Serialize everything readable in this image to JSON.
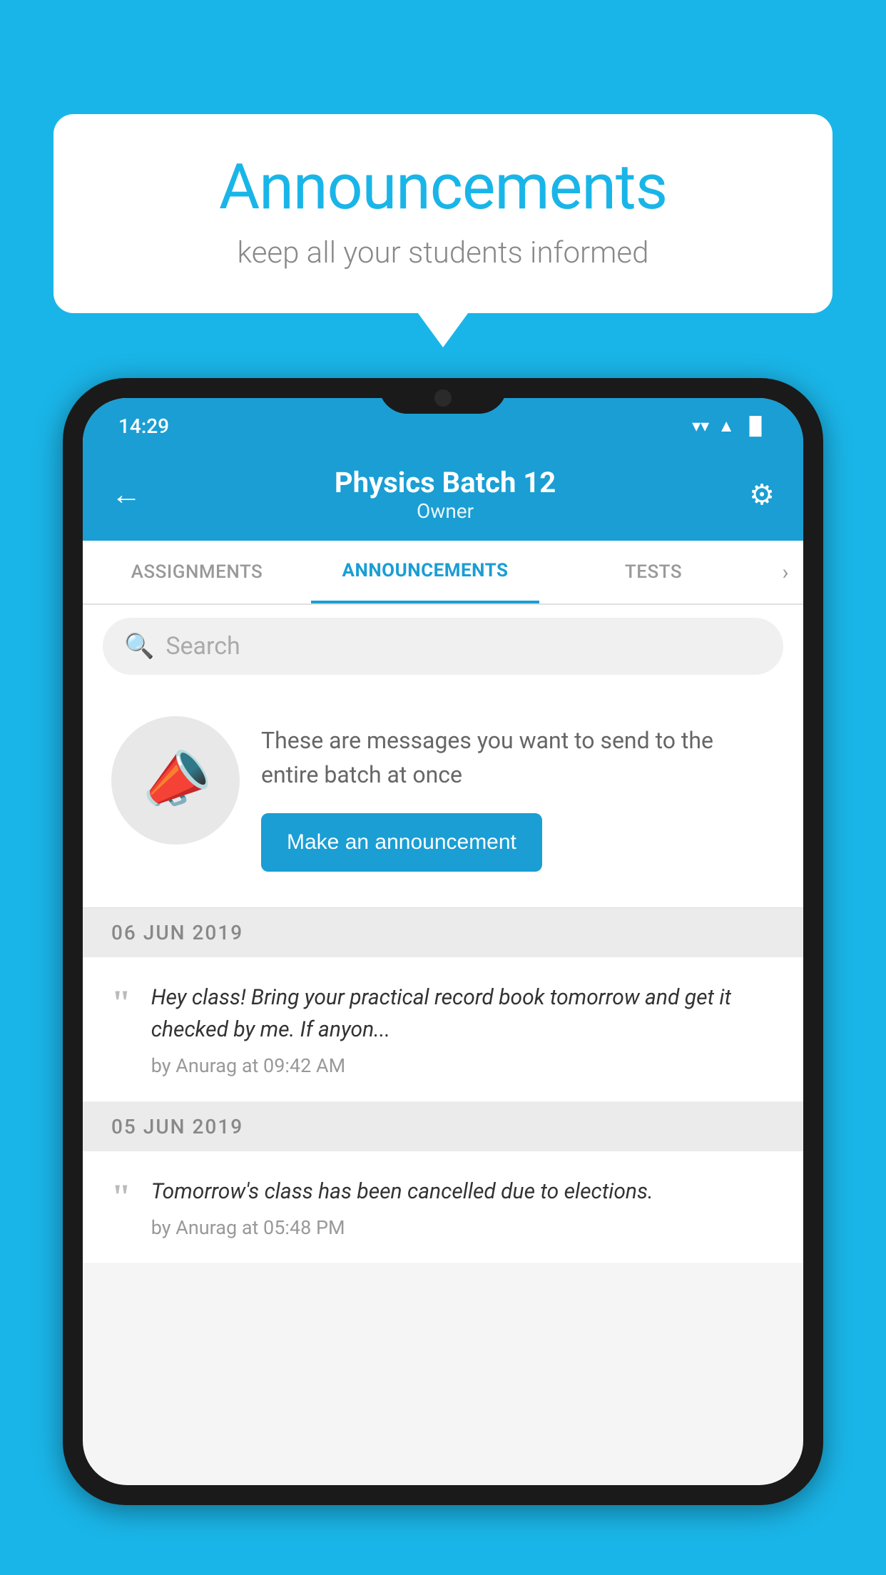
{
  "bubble": {
    "title": "Announcements",
    "subtitle": "keep all your students informed"
  },
  "statusBar": {
    "time": "14:29",
    "wifiIcon": "▼",
    "signalIcon": "▲",
    "batteryIcon": "▐"
  },
  "header": {
    "title": "Physics Batch 12",
    "subtitle": "Owner",
    "backLabel": "←",
    "settingsLabel": "⚙"
  },
  "tabs": [
    {
      "label": "ASSIGNMENTS",
      "active": false
    },
    {
      "label": "ANNOUNCEMENTS",
      "active": true
    },
    {
      "label": "TESTS",
      "active": false
    }
  ],
  "search": {
    "placeholder": "Search"
  },
  "promoCard": {
    "description": "These are messages you want to send to the entire batch at once",
    "buttonLabel": "Make an announcement"
  },
  "dates": [
    {
      "label": "06  JUN  2019",
      "announcements": [
        {
          "text": "Hey class! Bring your practical record book tomorrow and get it checked by me. If anyon...",
          "meta": "by Anurag at 09:42 AM"
        }
      ]
    },
    {
      "label": "05  JUN  2019",
      "announcements": [
        {
          "text": "Tomorrow's class has been cancelled due to elections.",
          "meta": "by Anurag at 05:48 PM"
        }
      ]
    }
  ],
  "colors": {
    "brand": "#1ab5e8",
    "appBar": "#1a9ed4",
    "white": "#ffffff",
    "lightGray": "#ebebeb",
    "textDark": "#333333",
    "textMid": "#666666",
    "textLight": "#999999"
  }
}
